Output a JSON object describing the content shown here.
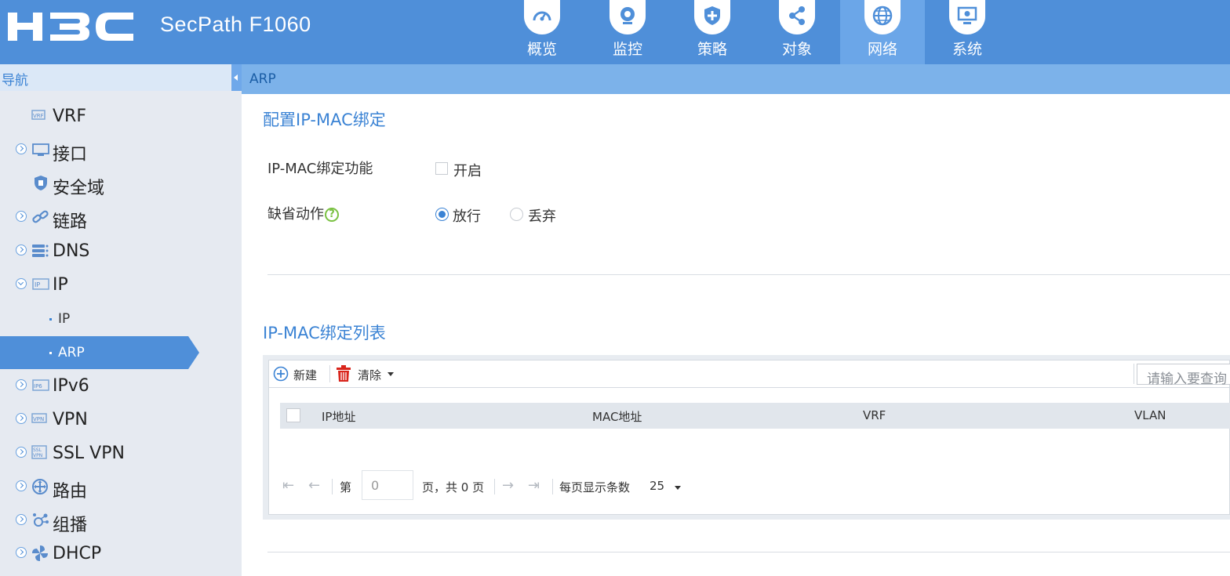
{
  "header": {
    "logo_text": "H3C",
    "product": "SecPath F1060",
    "tabs": [
      {
        "label": "概览",
        "icon": "dashboard-icon"
      },
      {
        "label": "监控",
        "icon": "camera-icon"
      },
      {
        "label": "策略",
        "icon": "shield-plus-icon"
      },
      {
        "label": "对象",
        "icon": "share-nodes-icon"
      },
      {
        "label": "网络",
        "icon": "globe-icon",
        "active": true
      },
      {
        "label": "系统",
        "icon": "monitor-gear-icon"
      }
    ]
  },
  "sidebar": {
    "title": "导航",
    "items": [
      {
        "label": "VRF",
        "icon": "vrf-icon"
      },
      {
        "label": "接口",
        "icon": "interface-icon"
      },
      {
        "label": "安全域",
        "icon": "security-zone-icon"
      },
      {
        "label": "链路",
        "icon": "link-icon"
      },
      {
        "label": "DNS",
        "icon": "dns-icon"
      },
      {
        "label": "IP",
        "icon": "ip-icon"
      },
      {
        "label": "IP"
      },
      {
        "label": "ARP",
        "active": true
      },
      {
        "label": "IPv6",
        "icon": "ipv6-icon"
      },
      {
        "label": "VPN",
        "icon": "vpn-icon"
      },
      {
        "label": "SSL VPN",
        "icon": "ssl-vpn-icon"
      },
      {
        "label": "路由",
        "icon": "routing-icon"
      },
      {
        "label": "组播",
        "icon": "multicast-icon"
      },
      {
        "label": "DHCP",
        "icon": "dhcp-icon"
      }
    ]
  },
  "breadcrumb": "ARP",
  "config": {
    "title": "配置IP-MAC绑定",
    "feature_label": "IP-MAC绑定功能",
    "enable_label": "开启",
    "enabled": false,
    "default_action_label": "缺省动作",
    "help_glyph": "?",
    "actions": [
      "放行",
      "丢弃"
    ],
    "selected_action": "放行"
  },
  "list": {
    "title": "IP-MAC绑定列表",
    "new_label": "新建",
    "clear_label": "清除",
    "search_placeholder": "请输入要查询",
    "columns": [
      "IP地址",
      "MAC地址",
      "VRF",
      "VLAN"
    ],
    "rows": [],
    "pager": {
      "page_prefix": "第",
      "page_value": "0",
      "page_suffix": "页，共 0 页",
      "per_page_label": "每页显示条数",
      "per_page_value": "25"
    }
  },
  "colors": {
    "header": "#4f8fd9",
    "active_tab": "#6ba6e8",
    "sidebar": "#e6eaf1",
    "accent": "#3b83d4",
    "breadcrumb_bar": "#7cb2ea",
    "clear_icon": "#d9251c"
  }
}
